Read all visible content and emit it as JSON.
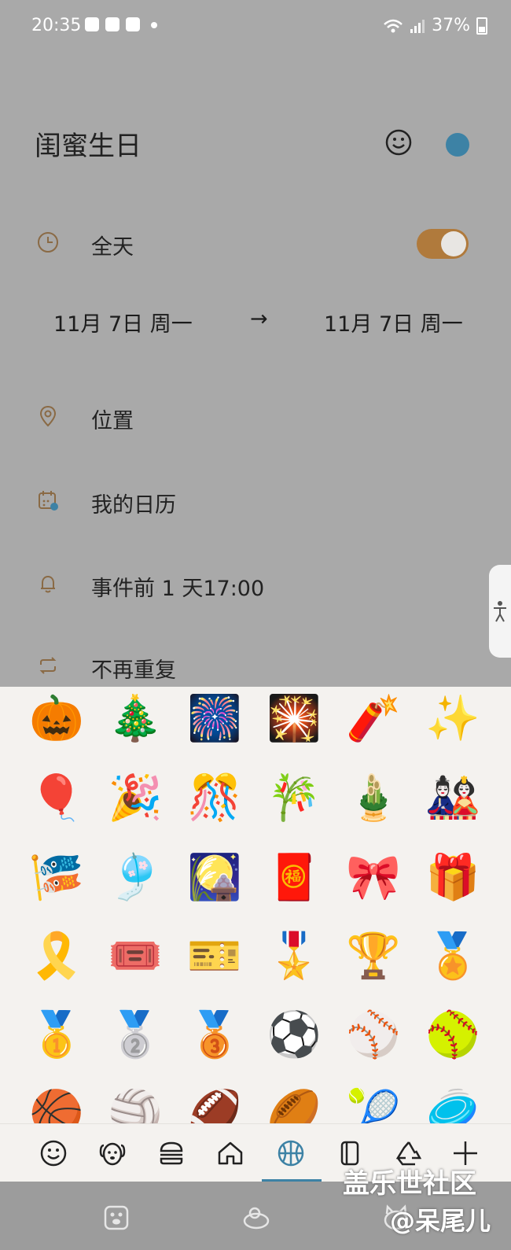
{
  "status": {
    "time": "20:35",
    "battery": "37%"
  },
  "event": {
    "title": "闺蜜生日",
    "color": "#3d82a5"
  },
  "allday": {
    "label": "全天",
    "on": true
  },
  "dates": {
    "start": "11月 7日 周一",
    "arrow": "→",
    "end": "11月 7日 周一"
  },
  "location": {
    "label": "位置"
  },
  "calendar": {
    "label": "我的日历"
  },
  "reminder": {
    "label": "事件前 1 天17:00"
  },
  "repeat": {
    "label": "不再重复"
  },
  "emojis": [
    [
      "🎃",
      "🎄",
      "🎆",
      "🎇",
      "🧨",
      "✨"
    ],
    [
      "🎈",
      "🎉",
      "🎊",
      "🎋",
      "🎍",
      "🎎"
    ],
    [
      "🎏",
      "🎐",
      "🎑",
      "🧧",
      "🎀",
      "🎁"
    ],
    [
      "🎗️",
      "🎟️",
      "🎫",
      "🎖️",
      "🏆",
      "🏅"
    ],
    [
      "🥇",
      "🥈",
      "🥉",
      "⚽",
      "⚾",
      "🥎"
    ],
    [
      "🏀",
      "🏐",
      "🏈",
      "🏉",
      "🎾",
      "🥏"
    ]
  ],
  "categories": [
    "smiley",
    "animal",
    "food",
    "travel",
    "activity",
    "objects",
    "symbols",
    "add"
  ],
  "active_category": "activity",
  "watermark": {
    "line1": "盖乐世社区",
    "line2": "@呆尾儿"
  }
}
